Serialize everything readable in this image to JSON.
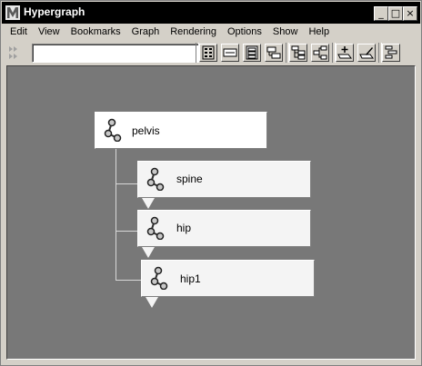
{
  "window": {
    "title": "Hypergraph",
    "minimize": "_",
    "maximize": "□",
    "close": "×"
  },
  "menu": [
    "Edit",
    "View",
    "Bookmarks",
    "Graph",
    "Rendering",
    "Options",
    "Show",
    "Help"
  ],
  "toolbar": {
    "input_value": "",
    "buttons": [
      "scene-hierarchy-icon",
      "frame-all-icon",
      "frame-selection-icon",
      "frame-hierarchy-icon",
      "up-downstream-icon",
      "input-output-icon",
      "add-bookmark-icon",
      "edit-bookmark-icon",
      "graph-layout-icon"
    ]
  },
  "nodes": [
    {
      "name": "pelvis"
    },
    {
      "name": "spine"
    },
    {
      "name": "hip"
    },
    {
      "name": "hip1"
    }
  ]
}
